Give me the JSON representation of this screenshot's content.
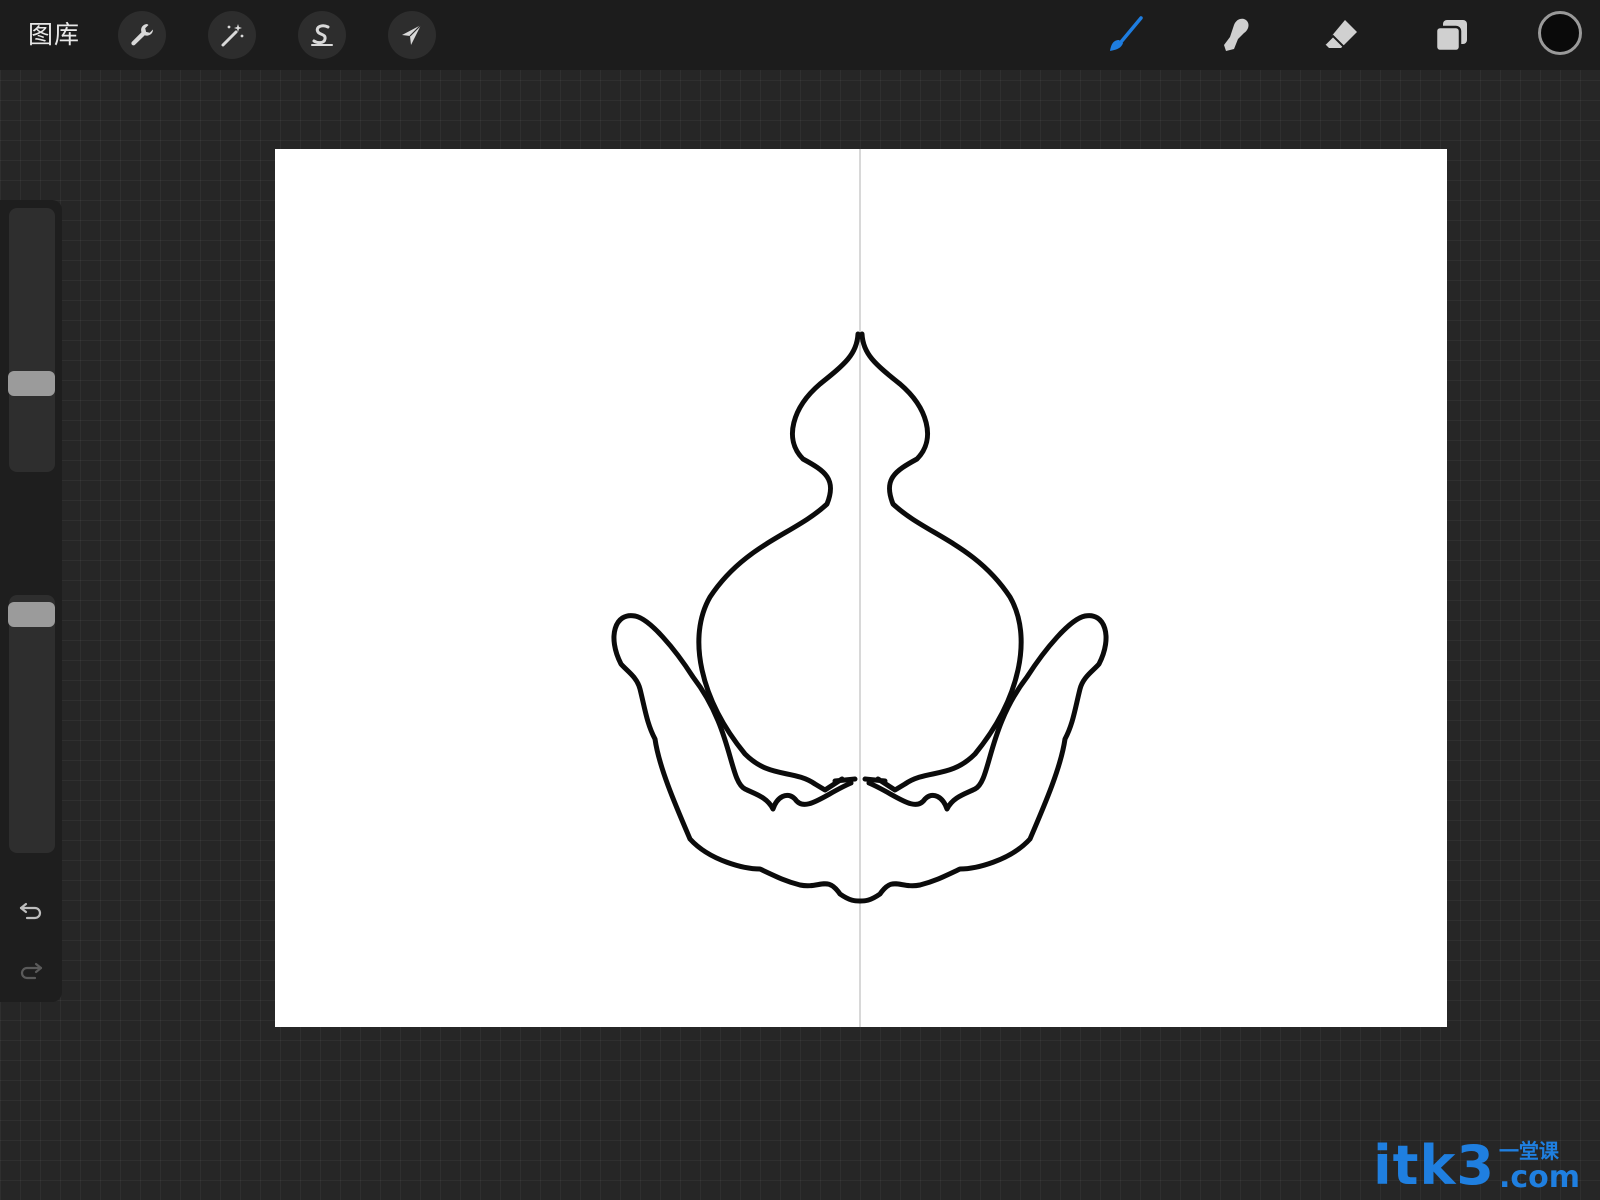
{
  "topbar": {
    "gallery_label": "图库",
    "left_tools": [
      {
        "name": "actions",
        "icon": "wrench-icon"
      },
      {
        "name": "adjustments",
        "icon": "magic-wand-icon"
      },
      {
        "name": "selection",
        "icon": "selection-s-icon"
      },
      {
        "name": "transform",
        "icon": "arrow-cursor-icon"
      }
    ],
    "right_tools": [
      {
        "name": "brush",
        "icon": "brush-icon",
        "active": true
      },
      {
        "name": "smudge",
        "icon": "smudge-finger-icon",
        "active": false
      },
      {
        "name": "eraser",
        "icon": "eraser-icon",
        "active": false
      },
      {
        "name": "layers",
        "icon": "layers-icon",
        "active": false
      }
    ],
    "current_color": "#0a0a0a",
    "active_tool_color": "#1e7de0"
  },
  "sidebar": {
    "brush_size_level": 0.32,
    "opacity_level": 0.97,
    "modify_icon": "square-modify-icon",
    "undo_icon": "undo-icon",
    "redo_icon": "redo-icon"
  },
  "canvas": {
    "background": "#ffffff",
    "symmetry_guide": "vertical",
    "drawing_icon": "gourd-outline-drawing"
  },
  "watermark": {
    "main": "itk3",
    "sub": "一堂课",
    "suffix": ".com",
    "color": "#1f7fe0"
  }
}
